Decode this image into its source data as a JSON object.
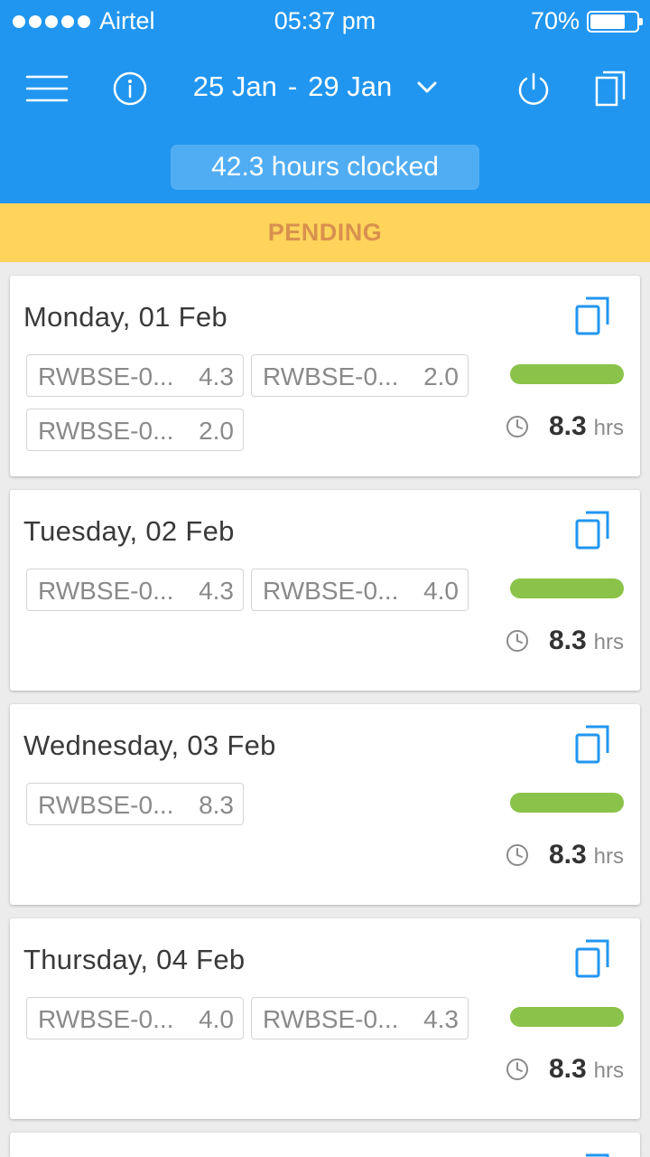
{
  "status_bar": {
    "carrier": "Airtel",
    "time": "05:37 pm",
    "battery": "70%"
  },
  "header": {
    "date_range_start": "25 Jan",
    "date_range_sep": "-",
    "date_range_end": "29 Jan",
    "hours_clocked": "42.3 hours clocked"
  },
  "status_banner": "PENDING",
  "colors": {
    "header": "#2196f0",
    "banner": "#ffd45a",
    "progress": "#8bc34a"
  },
  "days": [
    {
      "title": "Monday, 01 Feb",
      "entries": [
        {
          "code": "RWBSE-0...",
          "hours": "4.3"
        },
        {
          "code": "RWBSE-0...",
          "hours": "2.0"
        },
        {
          "code": "RWBSE-0...",
          "hours": "2.0"
        }
      ],
      "progress": 1.0,
      "total": "8.3",
      "unit": "hrs"
    },
    {
      "title": "Tuesday, 02 Feb",
      "entries": [
        {
          "code": "RWBSE-0...",
          "hours": "4.3"
        },
        {
          "code": "RWBSE-0...",
          "hours": "4.0"
        }
      ],
      "progress": 1.0,
      "total": "8.3",
      "unit": "hrs"
    },
    {
      "title": "Wednesday, 03 Feb",
      "entries": [
        {
          "code": "RWBSE-0...",
          "hours": "8.3"
        }
      ],
      "progress": 1.0,
      "total": "8.3",
      "unit": "hrs"
    },
    {
      "title": "Thursday, 04 Feb",
      "entries": [
        {
          "code": "RWBSE-0...",
          "hours": "4.0"
        },
        {
          "code": "RWBSE-0...",
          "hours": "4.3"
        }
      ],
      "progress": 1.0,
      "total": "8.3",
      "unit": "hrs"
    }
  ]
}
